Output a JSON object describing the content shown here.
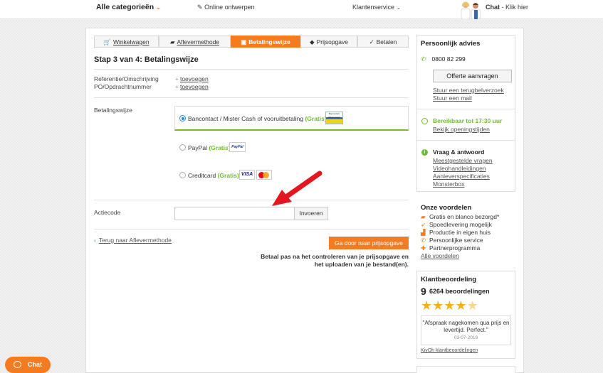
{
  "topbar": {
    "categories": "Alle categorieën",
    "online": "Online ontwerpen",
    "klantenservice": "Klantenservice",
    "chat_bold": "Chat",
    "chat_rest": " - Klik hier"
  },
  "steps": [
    {
      "label": "Winkelwagen",
      "icon": "cart-icon"
    },
    {
      "label": "Aflevermethode",
      "icon": "truck-icon"
    },
    {
      "label": "Betalingswijze",
      "icon": "wallet-icon"
    },
    {
      "label": "Prijsopgave",
      "icon": "tag-icon"
    },
    {
      "label": "Betalen",
      "icon": "check-icon"
    }
  ],
  "page_title": "Stap 3 van 4: Betalingswijze",
  "fields": {
    "referentie_label": "Referentie/Omschrijving",
    "po_label": "PO/Opdrachtnummer",
    "toevoegen": "toevoegen",
    "betalingswijze_label": "Betalingswijze",
    "actiecode_label": "Actiecode"
  },
  "payment": {
    "options": [
      {
        "name": "Bancontact / Mister Cash of vooruitbetaling",
        "gratis": "(Gratis)",
        "selected": true
      },
      {
        "name": "PayPal",
        "gratis": "(Gratis)",
        "selected": false
      },
      {
        "name": "Creditcard",
        "gratis": "(Gratis)",
        "selected": false
      }
    ],
    "logo_bancontact": "Bancontact Mister Cash",
    "logo_paypal": "PayPal",
    "logo_visa": "VISA"
  },
  "actiecode": {
    "value": "",
    "button": "Invoeren"
  },
  "nav": {
    "back": "Terug naar Aflevermethode",
    "continue": "Ga door naar prijsopgave",
    "note": "Betaal pas na het controleren van je prijsopgave en het uploaden van je bestand(en)."
  },
  "sidebar": {
    "advies_title": "Persoonlijk advies",
    "phone": "0800 82 299",
    "offerte_button": "Offerte aanvragen",
    "terugbel": "Stuur een terugbelverzoek",
    "mail": "Stuur een mail",
    "bereikbaar": "Bereikbaar tot 17:30 uur",
    "openingstijden": "Bekijk openingstijden",
    "vraag_title": "Vraag & antwoord",
    "vraag_links": [
      "Meestgestelde vragen",
      "Videohandleidingen",
      "Aanleverspecificaties",
      "Monsterbox"
    ],
    "voordelen_title": "Onze voordelen",
    "voordelen": [
      {
        "text": "Gratis en blanco bezorgd*",
        "icon": "truck-icon"
      },
      {
        "text": "Spoedlevering mogelijk",
        "icon": "rocket-icon"
      },
      {
        "text": "Productie in eigen huis",
        "icon": "factory-icon"
      },
      {
        "text": "Persoonlijke service",
        "icon": "phone-icon"
      },
      {
        "text": "Partnerprogramma",
        "icon": "partner-icon"
      }
    ],
    "alle_voordelen": "Alle voordelen",
    "klant_title": "Klantbeoordeling",
    "score": "9",
    "beoordelingen": "6264 beoordelingen",
    "rating": 4.5,
    "quote": "\"Afspraak nagekomen qua prijs en levertijd. Perfect.\"",
    "quote_date": "03-07-2019",
    "kiyoh": "KiyOh klantbeoordelingen"
  },
  "chat_button": "Chat",
  "colors": {
    "accent": "#f47b20",
    "green": "#6cbd2f",
    "radio_blue": "#2a8bd8",
    "arrow_red": "#e3171f"
  }
}
